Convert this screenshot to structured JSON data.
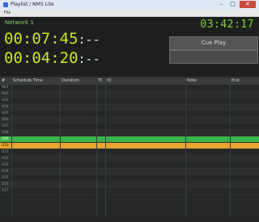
{
  "window": {
    "title": "Playlist / NMS Lite"
  },
  "menu": {
    "items": [
      "File"
    ]
  },
  "top": {
    "network_label": "Network 1",
    "clock": "03:42:17",
    "timer1": "00:07:45",
    "timer1_suffix": ":--",
    "timer2": "00:04:20",
    "timer2_suffix": ":--",
    "button1_label": "Cue Play",
    "button2_label": ""
  },
  "table": {
    "columns": [
      "#",
      "Schedule Time",
      "Duration",
      "TC",
      "ID",
      "Note",
      "End"
    ],
    "rows": [
      {
        "state": "normal",
        "cells": [
          "001",
          "",
          "",
          "",
          "",
          "",
          ""
        ]
      },
      {
        "state": "normal",
        "cells": [
          "002",
          "",
          "",
          "",
          "",
          "",
          ""
        ]
      },
      {
        "state": "normal",
        "cells": [
          "003",
          "",
          "",
          "",
          "",
          "",
          ""
        ]
      },
      {
        "state": "normal",
        "cells": [
          "004",
          "",
          "",
          "",
          "",
          "",
          ""
        ]
      },
      {
        "state": "normal",
        "cells": [
          "005",
          "",
          "",
          "",
          "",
          "",
          ""
        ]
      },
      {
        "state": "normal",
        "cells": [
          "006",
          "",
          "",
          "",
          "",
          "",
          ""
        ]
      },
      {
        "state": "normal",
        "cells": [
          "007",
          "",
          "",
          "",
          "",
          "",
          ""
        ]
      },
      {
        "state": "normal",
        "cells": [
          "008",
          "",
          "",
          "",
          "",
          "",
          ""
        ]
      },
      {
        "state": "live",
        "cells": [
          "009",
          "",
          "",
          "",
          "",
          "",
          ""
        ]
      },
      {
        "state": "next",
        "cells": [
          "010",
          "",
          "",
          "",
          "",
          "",
          ""
        ]
      },
      {
        "state": "normal",
        "cells": [
          "011",
          "",
          "",
          "",
          "",
          "",
          ""
        ]
      },
      {
        "state": "normal",
        "cells": [
          "012",
          "",
          "",
          "",
          "",
          "",
          ""
        ]
      },
      {
        "state": "normal",
        "cells": [
          "013",
          "",
          "",
          "",
          "",
          "",
          ""
        ]
      },
      {
        "state": "normal",
        "cells": [
          "014",
          "",
          "",
          "",
          "",
          "",
          ""
        ]
      },
      {
        "state": "normal",
        "cells": [
          "015",
          "",
          "",
          "",
          "",
          "",
          ""
        ]
      },
      {
        "state": "normal",
        "cells": [
          "016",
          "",
          "",
          "",
          "",
          "",
          ""
        ]
      },
      {
        "state": "normal",
        "cells": [
          "017",
          "",
          "",
          "",
          "",
          "",
          ""
        ]
      }
    ]
  },
  "colors": {
    "live_row": "#3bb44a",
    "next_row": "#e8a52c",
    "timer": "#c9e81c",
    "clock": "#7ad63a"
  }
}
